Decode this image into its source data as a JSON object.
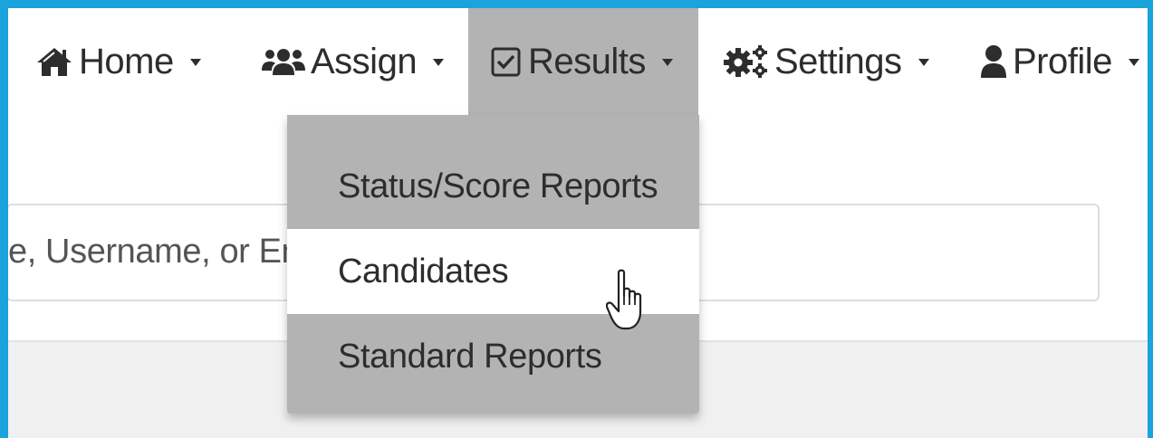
{
  "navbar": {
    "items": [
      {
        "label": "Home",
        "icon": "home-icon"
      },
      {
        "label": "Assign",
        "icon": "users-icon"
      },
      {
        "label": "Results",
        "icon": "checkbox-icon",
        "active": true
      },
      {
        "label": "Settings",
        "icon": "gears-icon"
      },
      {
        "label": "Profile",
        "icon": "user-icon"
      }
    ]
  },
  "search": {
    "visible_text": "e, Username, or Em"
  },
  "results_menu": {
    "items": [
      {
        "label": "Status/Score Reports"
      },
      {
        "label": "Candidates",
        "hovered": true
      },
      {
        "label": "Standard Reports"
      }
    ]
  },
  "colors": {
    "frame_border": "#1aa3dc",
    "active_nav_bg": "#b3b3b3",
    "dropdown_bg": "#b3b3b3",
    "hover_item_bg": "#ffffff",
    "panel_bg": "#f0f0f0",
    "text": "#2d2d2d"
  },
  "cursor": {
    "icon": "hand-pointer-icon"
  }
}
